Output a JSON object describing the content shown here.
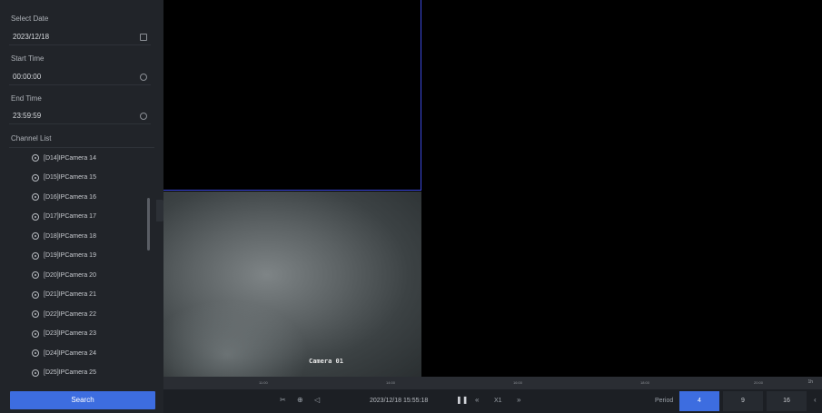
{
  "sidebar": {
    "select_date_label": "Select Date",
    "select_date_value": "2023/12/18",
    "start_time_label": "Start Time",
    "start_time_value": "00:00:00",
    "end_time_label": "End Time",
    "end_time_value": "23:59:59",
    "channel_list_label": "Channel List",
    "channels": [
      "[D14]IPCamera 14",
      "[D15]IPCamera 15",
      "[D16]IPCamera 16",
      "[D17]IPCamera 17",
      "[D18]IPCamera 18",
      "[D19]IPCamera 19",
      "[D20]IPCamera 20",
      "[D21]IPCamera 21",
      "[D22]IPCamera 22",
      "[D23]IPCamera 23",
      "[D24]IPCamera 24",
      "[D25]IPCamera 25"
    ],
    "search_label": "Search"
  },
  "video": {
    "camera_overlay": "Camera 01"
  },
  "timeline": {
    "ticks": [
      "11:00",
      "14:00",
      "16:00",
      "18:00",
      "20:00"
    ],
    "zoom_label": "1h"
  },
  "controls": {
    "playback_time": "2023/12/18 15:55:18",
    "speed": "X1",
    "period_label": "Period",
    "period_options": [
      "4",
      "9",
      "16"
    ],
    "period_selected": "4"
  },
  "colors": {
    "accent": "#3d6de0",
    "selection_border": "#3d4ae0"
  }
}
